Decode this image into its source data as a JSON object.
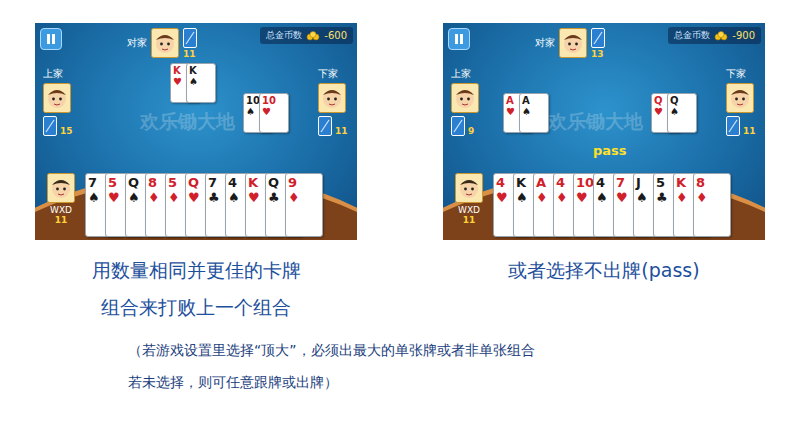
{
  "screens": [
    {
      "coins_label": "总金币数",
      "coins": "-600",
      "watermark": "欢乐锄大地",
      "seats": {
        "partner": {
          "label": "对家",
          "count": "11"
        },
        "left": {
          "label": "上家",
          "count": "15"
        },
        "right": {
          "label": "下家",
          "count": "11"
        }
      },
      "played": {
        "partner": [
          {
            "rank": "K",
            "suit": "♥",
            "color": "#d0202a"
          },
          {
            "rank": "K",
            "suit": "♠",
            "color": "#1a1a1a"
          }
        ],
        "left": [],
        "right": [
          {
            "rank": "10",
            "suit": "♠",
            "color": "#1a1a1a"
          },
          {
            "rank": "10",
            "suit": "♥",
            "color": "#d0202a"
          }
        ]
      },
      "player": {
        "name": "WXD",
        "count": "11",
        "hand": [
          {
            "rank": "7",
            "suit": "♠",
            "color": "#1a1a1a"
          },
          {
            "rank": "5",
            "suit": "♥",
            "color": "#d0202a"
          },
          {
            "rank": "Q",
            "suit": "♠",
            "color": "#1a1a1a"
          },
          {
            "rank": "8",
            "suit": "♦",
            "color": "#d0202a"
          },
          {
            "rank": "5",
            "suit": "♦",
            "color": "#d0202a"
          },
          {
            "rank": "Q",
            "suit": "♥",
            "color": "#d0202a"
          },
          {
            "rank": "7",
            "suit": "♣",
            "color": "#1a1a1a"
          },
          {
            "rank": "4",
            "suit": "♠",
            "color": "#1a1a1a"
          },
          {
            "rank": "K",
            "suit": "♥",
            "color": "#d0202a"
          },
          {
            "rank": "Q",
            "suit": "♣",
            "color": "#1a1a1a"
          },
          {
            "rank": "9",
            "suit": "♦",
            "color": "#d0202a"
          }
        ]
      }
    },
    {
      "coins_label": "总金币数",
      "coins": "-900",
      "watermark": "欢乐锄大地",
      "status_text": "pass",
      "seats": {
        "partner": {
          "label": "对家",
          "count": "13"
        },
        "left": {
          "label": "上家",
          "count": "9"
        },
        "right": {
          "label": "下家",
          "count": "11"
        }
      },
      "played": {
        "partner": [],
        "left": [
          {
            "rank": "A",
            "suit": "♥",
            "color": "#d0202a"
          },
          {
            "rank": "A",
            "suit": "♠",
            "color": "#1a1a1a"
          }
        ],
        "right": [
          {
            "rank": "Q",
            "suit": "♥",
            "color": "#d0202a"
          },
          {
            "rank": "Q",
            "suit": "♠",
            "color": "#1a1a1a"
          }
        ]
      },
      "player": {
        "name": "WXD",
        "count": "11",
        "hand": [
          {
            "rank": "4",
            "suit": "♥",
            "color": "#d0202a"
          },
          {
            "rank": "K",
            "suit": "♠",
            "color": "#1a1a1a"
          },
          {
            "rank": "A",
            "suit": "♦",
            "color": "#d0202a"
          },
          {
            "rank": "4",
            "suit": "♦",
            "color": "#d0202a"
          },
          {
            "rank": "10",
            "suit": "♥",
            "color": "#d0202a"
          },
          {
            "rank": "4",
            "suit": "♠",
            "color": "#1a1a1a"
          },
          {
            "rank": "7",
            "suit": "♥",
            "color": "#d0202a"
          },
          {
            "rank": "J",
            "suit": "♠",
            "color": "#1a1a1a"
          },
          {
            "rank": "5",
            "suit": "♣",
            "color": "#1a1a1a"
          },
          {
            "rank": "K",
            "suit": "♦",
            "color": "#d0202a"
          },
          {
            "rank": "8",
            "suit": "♦",
            "color": "#d0202a"
          }
        ]
      }
    }
  ],
  "captions": [
    [
      "用数量相同并更佳的卡牌",
      "组合来打败上一个组合"
    ],
    [
      "或者选择不出牌(pass)"
    ]
  ],
  "note": [
    "（若游戏设置里选择“顶大”，必须出最大的单张牌或者非单张组合",
    "若未选择，则可任意跟牌或出牌）"
  ]
}
